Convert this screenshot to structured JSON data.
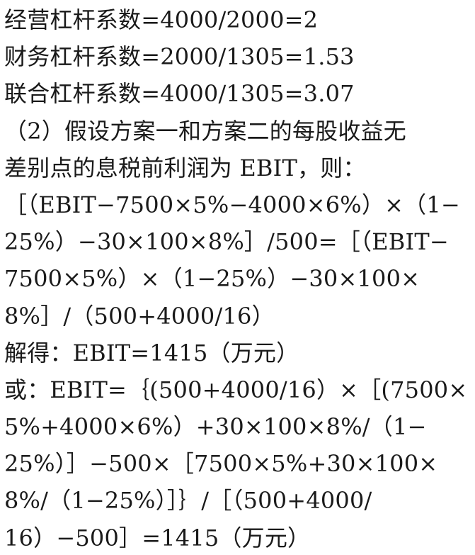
{
  "document": {
    "lines": [
      "经营杠杆系数=4000/2000=2",
      "财务杠杆系数=2000/1305=1.53",
      "联合杠杆系数=4000/1305=3.07",
      "（2）假设方案一和方案二的每股收益无",
      "差别点的息税前利润为 EBIT，则：",
      "［（EBIT−7500×5%−4000×6%）×（1−",
      "25%）−30×100×8%］/500=［（EBIT−",
      "7500×5%）×（1−25%）−30×100×",
      "8%］/（500+4000/16）",
      "解得：EBIT=1415（万元）",
      "或：EBIT=｛(500+4000/16）×［(7500×",
      "5%+4000×6%）+30×100×8%/（1−",
      "25%）］−500×［7500×5%+30×100×",
      "8%/（1−25%）］｝/［（500+4000/",
      "16）−500］=1415（万元）"
    ]
  }
}
